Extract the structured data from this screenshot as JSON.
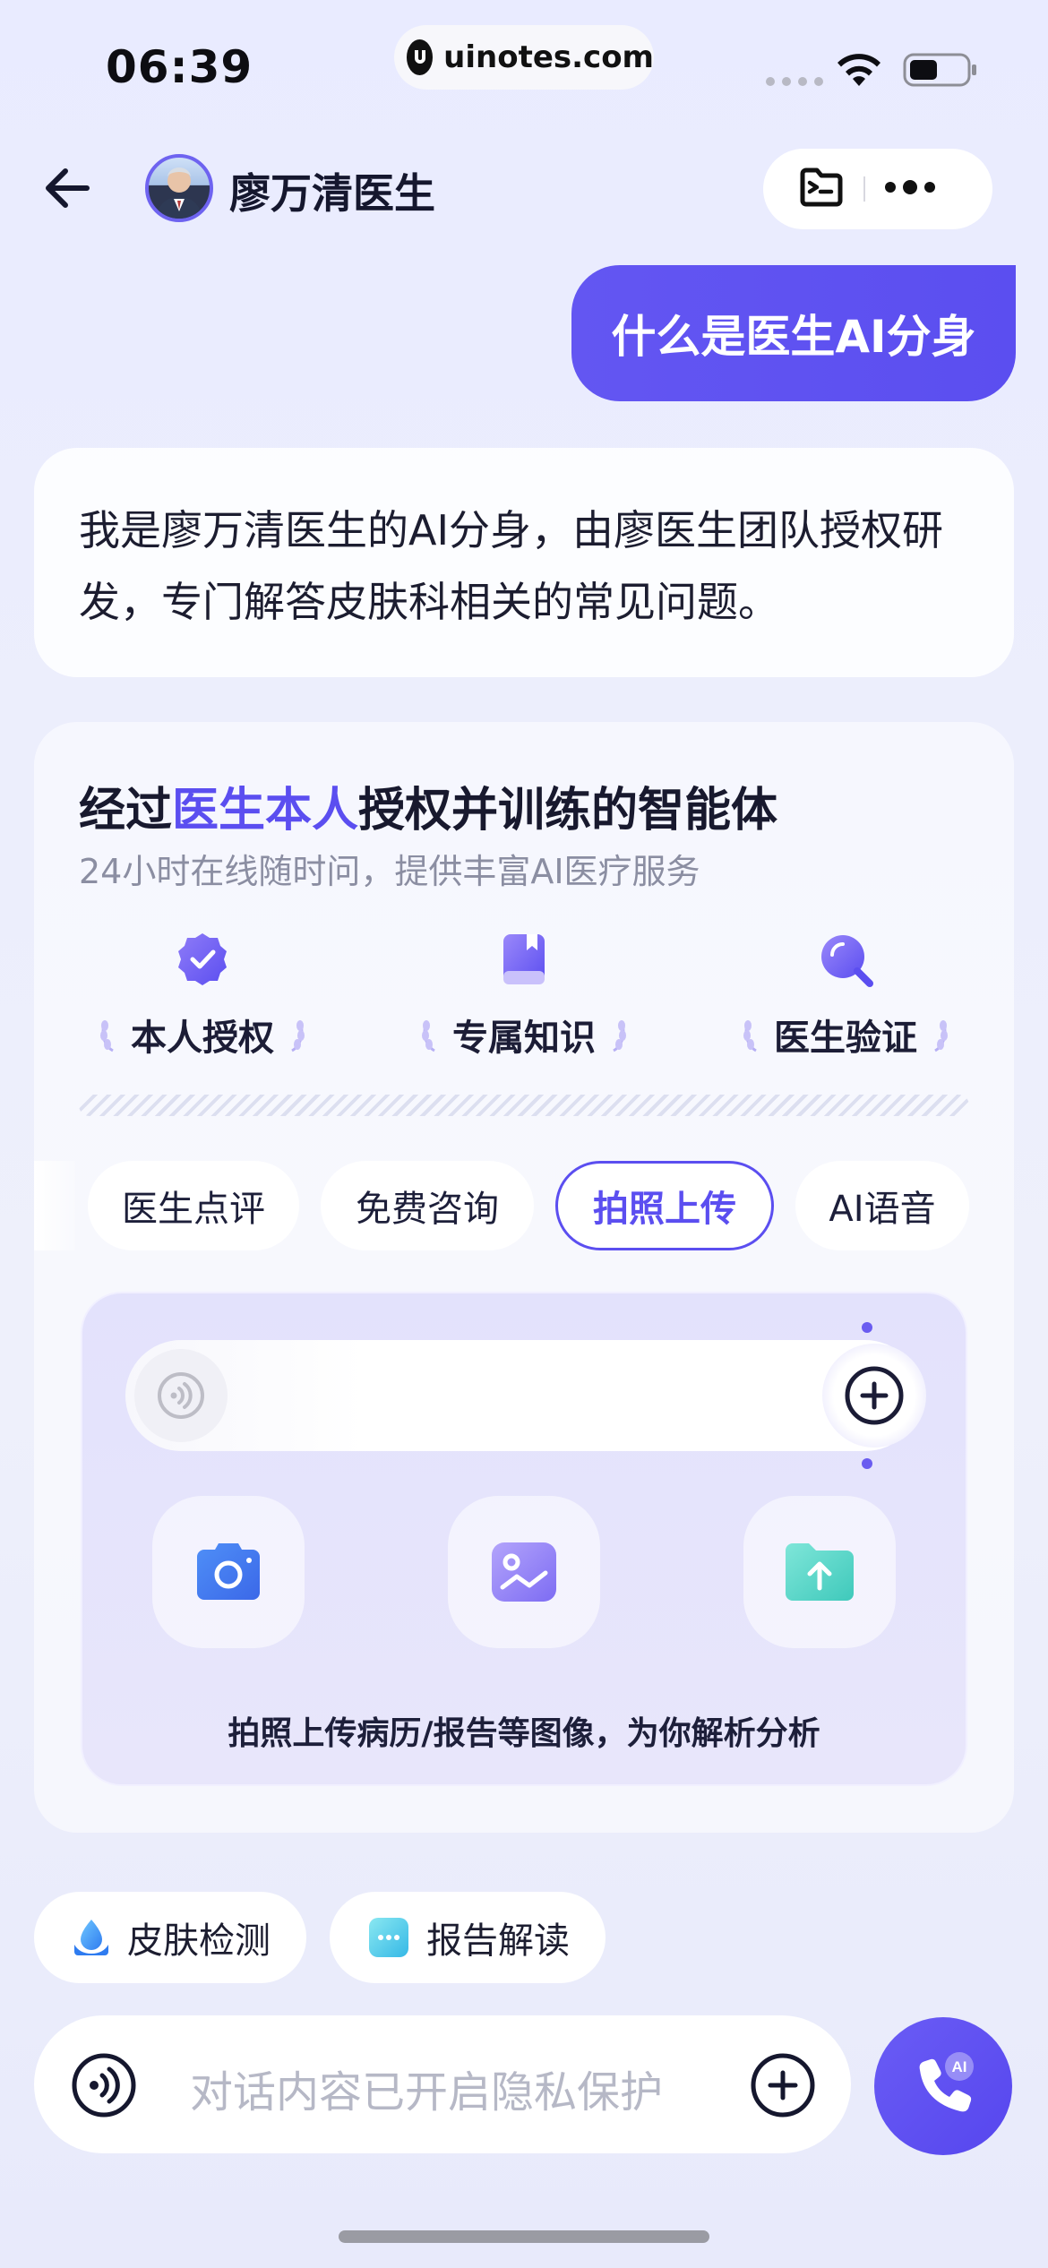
{
  "status_bar": {
    "time": "06:39",
    "url": "uinotes.com"
  },
  "header": {
    "doctor_name": "廖万清医生"
  },
  "user_message": "什么是医生AI分身",
  "ai_reply": "我是廖万清医生的AI分身，由廖医生团队授权研发，专门解答皮肤科相关的常见问题。",
  "intro_card": {
    "title_prefix": "经过",
    "title_highlight": "医生本人",
    "title_suffix": "授权并训练的智能体",
    "subtitle": "24小时在线随时问，提供丰富AI医疗服务",
    "features": [
      "本人授权",
      "专属知识",
      "医生验证"
    ]
  },
  "tabs": [
    "医生点评",
    "免费咨询",
    "拍照上传",
    "AI语音"
  ],
  "active_tab": "拍照上传",
  "upload_panel": {
    "hint": "拍照上传病历/报告等图像，为你解析分析",
    "actions": [
      "camera",
      "gallery",
      "file-upload"
    ]
  },
  "quick_chips": [
    "皮肤检测",
    "报告解读"
  ],
  "input": {
    "placeholder": "对话内容已开启隐私保护"
  },
  "call_badge": "AI",
  "colors": {
    "accent": "#5b4ef0",
    "background": "#eceefc"
  }
}
